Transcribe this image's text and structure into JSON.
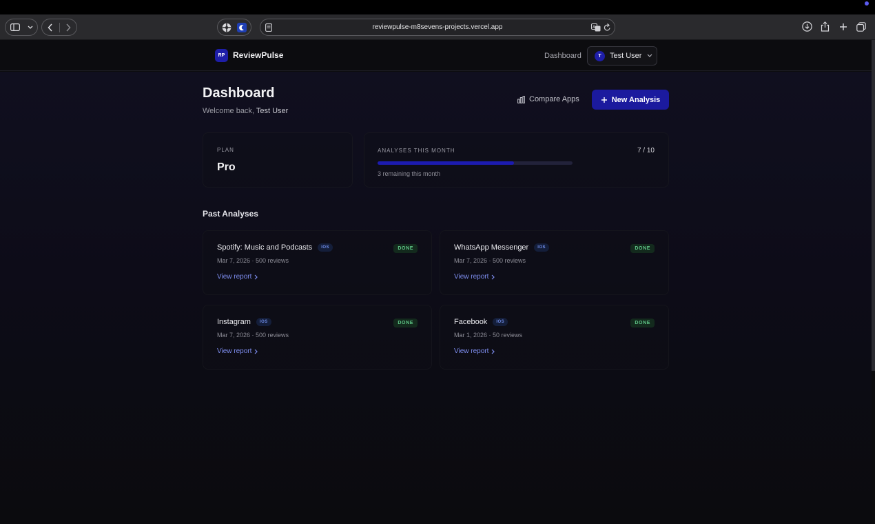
{
  "browser": {
    "url": "reviewpulse-m8sevens-projects.vercel.app",
    "icons": {
      "sidebar": "sidebar-icon",
      "back": "chevron-left-icon",
      "forward": "chevron-right-icon",
      "extension1": "extension-icon",
      "extension2": "moon-extension-icon",
      "translate": "translate-icon",
      "reload": "reload-icon",
      "download": "download-icon",
      "share": "share-icon",
      "new_tab": "plus-icon",
      "tabs": "tabs-overview-icon"
    }
  },
  "nav": {
    "logo_initials": "RP",
    "app_name": "ReviewPulse",
    "dashboard_link": "Dashboard",
    "user_initial": "T",
    "user_name": "Test User"
  },
  "header": {
    "title": "Dashboard",
    "welcome_prefix": "Welcome back, ",
    "welcome_name": "Test User",
    "compare_label": "Compare Apps",
    "new_analysis_label": "New Analysis"
  },
  "plan": {
    "label": "PLAN",
    "value": "Pro"
  },
  "usage": {
    "label": "ANALYSES THIS MONTH",
    "count": "7 / 10",
    "used": 7,
    "limit": 10,
    "remaining_text": "3 remaining this month"
  },
  "past": {
    "title": "Past Analyses",
    "view_label": "View report",
    "items": [
      {
        "app": "Spotify: Music and Podcasts",
        "platform": "IOS",
        "status": "DONE",
        "meta": "Mar 7, 2026 · 500 reviews"
      },
      {
        "app": "WhatsApp Messenger",
        "platform": "IOS",
        "status": "DONE",
        "meta": "Mar 7, 2026 · 500 reviews"
      },
      {
        "app": "Instagram",
        "platform": "IOS",
        "status": "DONE",
        "meta": "Mar 7, 2026 · 500 reviews"
      },
      {
        "app": "Facebook",
        "platform": "IOS",
        "status": "DONE",
        "meta": "Mar 1, 2026 · 50 reviews"
      }
    ]
  },
  "colors": {
    "accent": "#1b1a9e",
    "done_green": "#5fc587",
    "link_blue": "#7e8ef0"
  }
}
